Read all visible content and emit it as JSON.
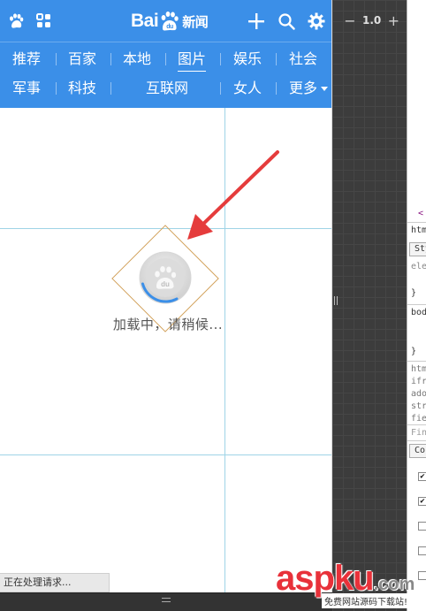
{
  "header": {
    "logo_text": "Bai",
    "logo_badge": "du",
    "logo_suffix": "新闻"
  },
  "nav_row_1": [
    "推荐",
    "百家",
    "本地",
    "图片",
    "娱乐",
    "社会"
  ],
  "nav_row_2": [
    "军事",
    "科技",
    "互联网",
    "女人",
    "更多"
  ],
  "active_tab": "图片",
  "loader": {
    "badge": "du",
    "text": "加载中，请稍候..."
  },
  "status_bar": "正在处理请求...",
  "zoom": {
    "minus": "−",
    "value": "1.0",
    "plus": "+"
  },
  "devtools": {
    "fragments": [
      "<",
      "htm",
      "Sty",
      "ele",
      "}",
      "bod",
      "}",
      "htm",
      "ifr",
      "ado",
      "str",
      "fie",
      "Fin",
      "Co"
    ],
    "checkboxes": [
      true,
      true,
      false,
      false,
      false
    ]
  },
  "watermark": {
    "logo_a": "asp",
    "logo_b": "ku",
    "logo_c": ".com",
    "subtitle": "免费网站源码下载站!"
  },
  "colors": {
    "header_bg": "#3b8fe8",
    "guide_line": "#9fd4e6",
    "arrow": "#e53c3c",
    "spinner": "#3b8fe8"
  }
}
